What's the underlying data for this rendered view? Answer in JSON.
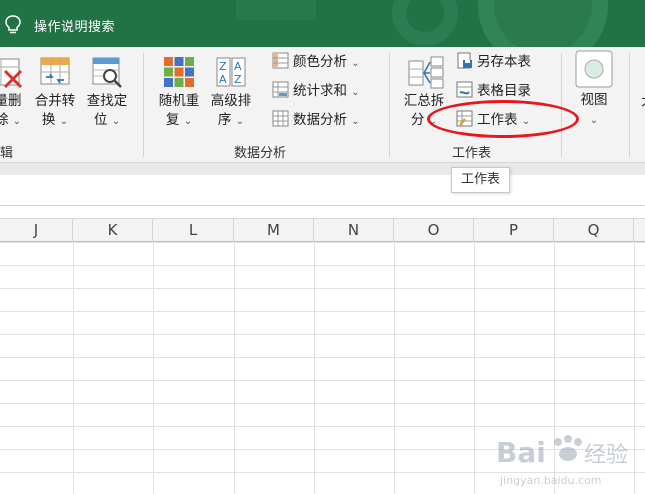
{
  "tell_me": "操作说明搜索",
  "ribbon": {
    "buttons": {
      "batch_delete": {
        "label1": "量删",
        "label2": "除"
      },
      "merge_convert": {
        "label1": "合并转",
        "label2": "换"
      },
      "find_locate": {
        "label1": "查找定",
        "label2": "位"
      },
      "random_reorder": {
        "label1": "随机重",
        "label2": "复"
      },
      "advanced_sort": {
        "label1": "高级排",
        "label2": "序"
      },
      "color_analysis": "颜色分析",
      "stat_sum": "统计求和",
      "data_analysis": "数据分析",
      "summary_split": {
        "label1": "汇总拆",
        "label2": "分"
      },
      "save_as_sheet": "另存本表",
      "sheet_directory": "表格目录",
      "worksheet": "工作表",
      "view": {
        "label1": "视图"
      }
    },
    "groups": {
      "edit": "辑",
      "data_analysis": "数据分析",
      "worksheet": "工作表"
    },
    "right_edge_label": "才"
  },
  "tooltip": "工作表",
  "columns": [
    "J",
    "K",
    "L",
    "M",
    "N",
    "O",
    "P",
    "Q"
  ],
  "watermark": {
    "brand": "Bai",
    "suffix": "经验",
    "url": "jingyan.baidu.com"
  },
  "colors": {
    "title_bar": "#217346",
    "annotation": "#e8171b",
    "ribbon_bg": "#f3f3f3"
  }
}
